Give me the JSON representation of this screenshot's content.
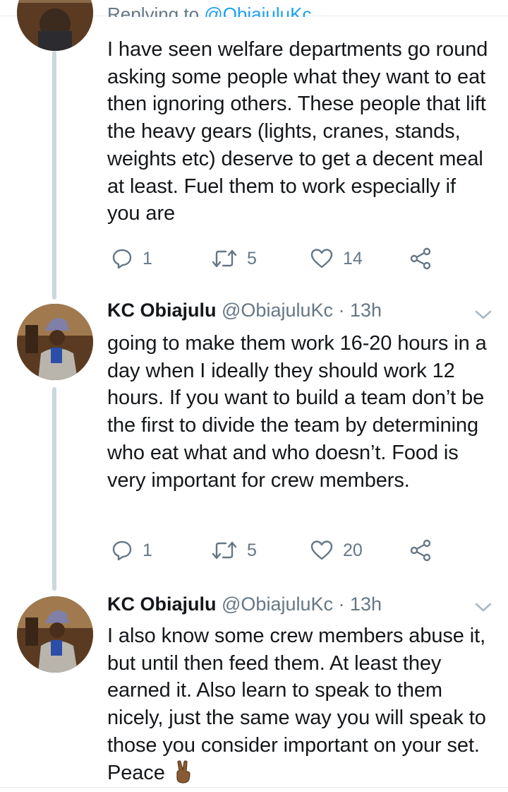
{
  "reply_context": {
    "prefix": "Replying to",
    "handle": "@ObiajuluKc"
  },
  "tweets": [
    {
      "text": "I have seen welfare departments go round asking some people what they want to eat then ignoring others. These people that lift the heavy gears (lights, cranes, stands, weights etc) deserve to get a decent meal at least. Fuel them to work especially if you are",
      "replies": "1",
      "retweets": "5",
      "likes": "14"
    },
    {
      "name": "KC Obiajulu",
      "handle": "@ObiajuluKc",
      "time": "· 13h",
      "text": "going to make them work 16-20 hours in a day when I ideally they should work 12 hours. If you want to build a team don’t be the first to divide the team by determining who eat what and who doesn’t. Food is very important for crew members.",
      "replies": "1",
      "retweets": "5",
      "likes": "20"
    },
    {
      "name": "KC Obiajulu",
      "handle": "@ObiajuluKc",
      "time": "· 13h",
      "text": "I also know some crew members abuse it, but until then feed them. At least they earned it. Also learn to speak to them nicely, just the same way you will speak to those you consider important on your set. Peace",
      "emoji": "victory-hand-emoji"
    }
  ],
  "icons": {
    "reply": "reply-icon",
    "retweet": "retweet-icon",
    "like": "heart-icon",
    "share": "share-icon",
    "menu": "chevron-down-icon"
  },
  "colors": {
    "text": "#14171a",
    "secondary": "#657786",
    "link": "#1da1f2",
    "thread_line": "#ccd6dd",
    "divider": "#e6ecf0"
  }
}
